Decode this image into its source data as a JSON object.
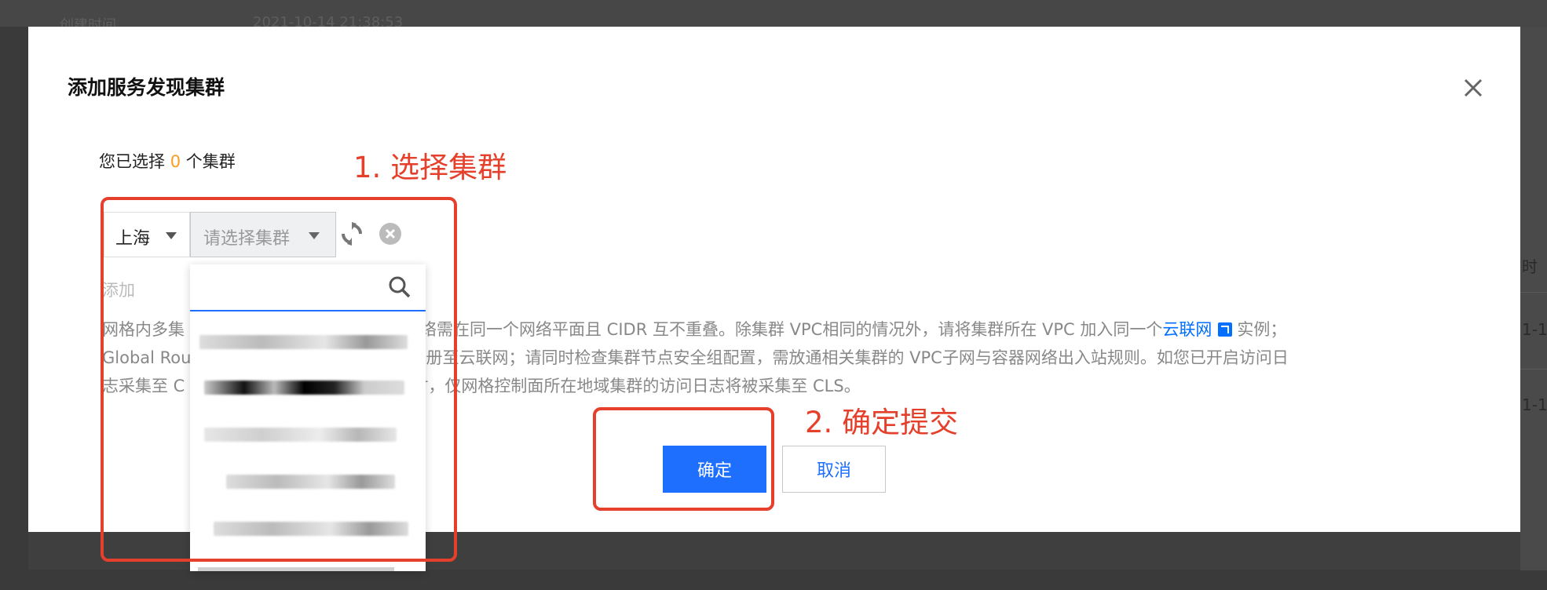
{
  "background": {
    "top_label": "创建时间",
    "top_time": "2021-10-14 21:38:53",
    "right_header": "时",
    "right_row_1": "1-1",
    "right_row_2": "1-1"
  },
  "dialog": {
    "title": "添加服务发现集群",
    "selected_prefix": "您已选择",
    "selected_count": "0",
    "selected_suffix": "个集群",
    "region": "上海",
    "cluster_placeholder": "请选择集群",
    "add_label": "添加",
    "description": {
      "line1_start": "网格内多集",
      "line1_mid": "群网络需在同一个网络平面且 CIDR 互不重叠。除集群 VPC相同的情况外，请将集群所在 VPC 加入同一个",
      "link": "云联网",
      "line1_end": "实例；",
      "line2_start": "Global Rou",
      "line2_mid": "注册至云联网；请同时检查集群节点安全组配置，需放通相关集群的 VPC子网与容器网络出入站规则。如您已开启访问日",
      "line3_start": "志采集至 C",
      "line3_mid": "群时，仅网格控制面所在地域集群的访问日志将被采集至 CLS。"
    },
    "confirm_label": "确定",
    "cancel_label": "取消",
    "search_placeholder": ""
  },
  "annotations": {
    "step1": "1. 选择集群",
    "step2": "2. 确定提交",
    "color": "#e5402c"
  },
  "colors": {
    "primary": "#1f6fff",
    "count": "#ff9c19"
  }
}
